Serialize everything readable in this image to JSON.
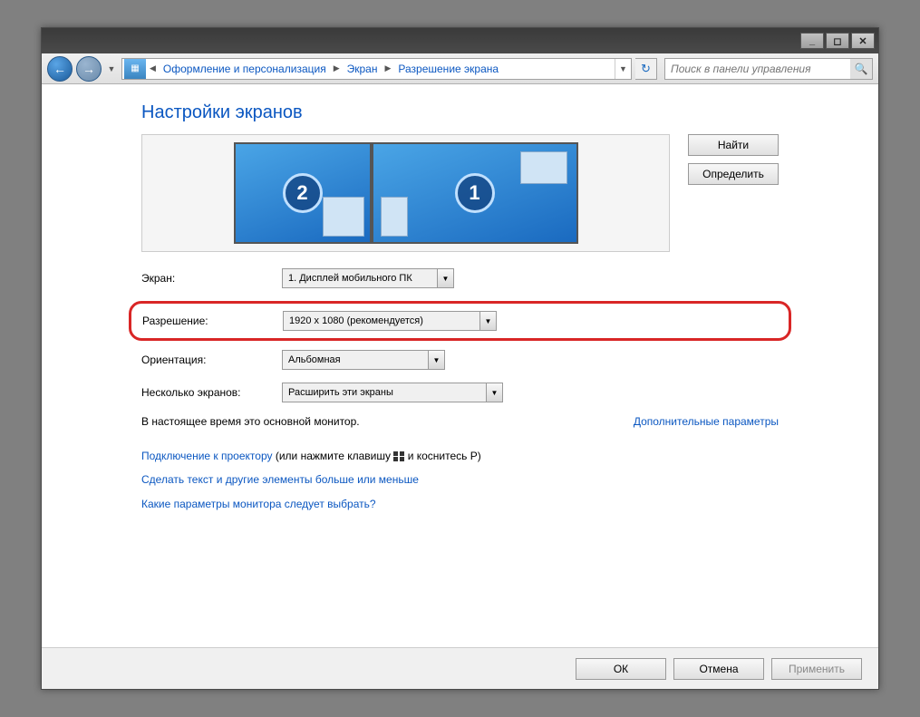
{
  "titlebar": {
    "min": "_",
    "max": "◻",
    "close": "✕"
  },
  "nav": {
    "breadcrumbs": [
      "Оформление и персонализация",
      "Экран",
      "Разрешение экрана"
    ],
    "search_placeholder": "Поиск в панели управления"
  },
  "page": {
    "title": "Настройки экранов",
    "monitors": {
      "m1_label": "1",
      "m2_label": "2"
    },
    "buttons": {
      "detect": "Найти",
      "identify": "Определить"
    }
  },
  "form": {
    "display_label": "Экран:",
    "display_value": "1. Дисплей мобильного ПК",
    "resolution_label": "Разрешение:",
    "resolution_value": "1920 x 1080 (рекомендуется)",
    "orientation_label": "Ориентация:",
    "orientation_value": "Альбомная",
    "multi_label": "Несколько экранов:",
    "multi_value": "Расширить эти экраны"
  },
  "status": {
    "primary": "В настоящее время это основной монитор.",
    "advanced": "Дополнительные параметры"
  },
  "links": {
    "projector_a": "Подключение к проектору",
    "projector_b": "(или нажмите клавишу",
    "projector_c": "и коснитесь P)",
    "text_size": "Сделать текст и другие элементы больше или меньше",
    "which": "Какие параметры монитора следует выбрать?"
  },
  "footer": {
    "ok": "ОК",
    "cancel": "Отмена",
    "apply": "Применить"
  }
}
